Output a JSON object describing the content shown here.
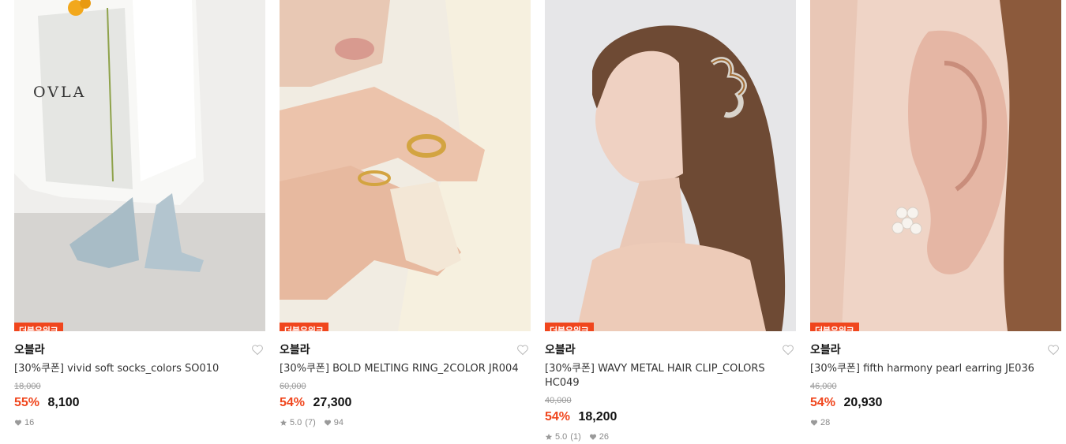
{
  "products": [
    {
      "badge": "더블유위크",
      "brand": "오블라",
      "title": "[30%쿠폰] vivid soft socks_colors SO010",
      "original_price": "18,000",
      "discount": "55%",
      "price": "8,100",
      "rating": null,
      "review_count": null,
      "likes": "16",
      "image_label": "OVLA"
    },
    {
      "badge": "더블유위크",
      "brand": "오블라",
      "title": "[30%쿠폰] BOLD MELTING RING_2COLOR JR004",
      "original_price": "60,000",
      "discount": "54%",
      "price": "27,300",
      "rating": "5.0",
      "review_count": "(7)",
      "likes": "94"
    },
    {
      "badge": "더블유위크",
      "brand": "오블라",
      "title": "[30%쿠폰] WAVY METAL HAIR CLIP_COLORS HC049",
      "original_price": "40,000",
      "discount": "54%",
      "price": "18,200",
      "rating": "5.0",
      "review_count": "(1)",
      "likes": "26"
    },
    {
      "badge": "더블유위크",
      "brand": "오블라",
      "title": "[30%쿠폰] fifth harmony pearl earring JE036",
      "original_price": "46,000",
      "discount": "54%",
      "price": "20,930",
      "rating": null,
      "review_count": null,
      "likes": "28"
    }
  ],
  "icons": {
    "wishlist": "heart-outline-icon",
    "like": "heart-filled-icon",
    "rating": "star-icon"
  },
  "colors": {
    "accent": "#f0461d",
    "price": "#111111",
    "muted": "#9a9a9a"
  }
}
